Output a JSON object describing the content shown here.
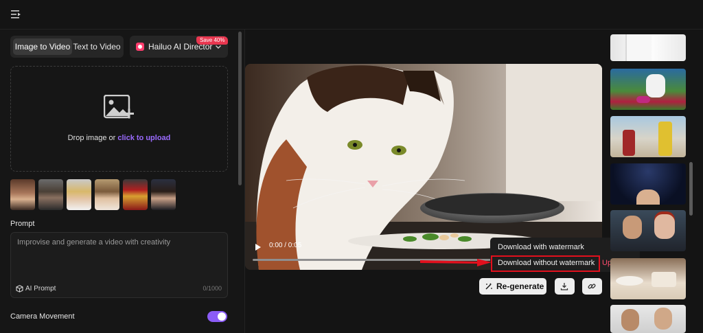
{
  "left_panel": {
    "tabs": [
      {
        "label": "Image to Video",
        "active": true
      },
      {
        "label": "Text to Video",
        "active": false
      }
    ],
    "director": {
      "label": "Hailuo AI Director",
      "badge": "Save 40%"
    },
    "upload": {
      "text": "Drop image or ",
      "link": "click to upload"
    },
    "sample_thumbnails": [
      "woman-portrait",
      "bearded-man",
      "blonde-woman",
      "curly-woman",
      "iron-suit",
      "dark-haired-woman"
    ],
    "prompt": {
      "label": "Prompt",
      "placeholder": "Improvise and generate a video with creativity",
      "ai_prompt": "AI Prompt",
      "char_count": "0/1000"
    },
    "camera_movement": {
      "label": "Camera Movement",
      "enabled": true
    }
  },
  "player": {
    "time": "0:00 / 0:05",
    "progress": 0
  },
  "download_menu": {
    "with_watermark": "Download with watermark",
    "without_watermark": "Download without watermark",
    "upgrade": "Upgrade"
  },
  "actions": {
    "regenerate": "Re-generate"
  },
  "gallery": [
    "woman-white-shirt",
    "cartoon-cat-garden",
    "action-figures-desert",
    "starry-sky-portrait",
    "couple-portrait",
    "food-table",
    "two-men-portrait"
  ],
  "colors": {
    "accent": "#8b5cf6",
    "highlight": "#e3101d",
    "badge": "#e8364f",
    "upgrade": "#ff4d6d"
  }
}
